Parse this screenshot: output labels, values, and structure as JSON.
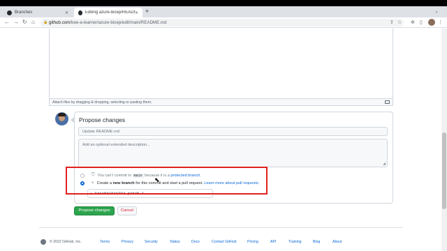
{
  "browser": {
    "tabs": [
      {
        "title": "Branches",
        "active": false
      },
      {
        "title": "Editing azure-bicep/README.m",
        "active": true
      }
    ],
    "new_tab_label": "+",
    "url_host": "github.com",
    "url_path": "/bee-a-learner/azure-bicep/edit/main/README.md"
  },
  "editor": {
    "attach_hint": "Attach files by dragging & dropping, selecting or pasting them."
  },
  "propose": {
    "title": "Propose changes",
    "summary_placeholder": "Update README.md",
    "description_placeholder": "Add an optional extended description...",
    "option_direct": {
      "prefix": "You can't commit to",
      "branch": "main",
      "middle": "because it is a",
      "link": "protected branch",
      "suffix": "."
    },
    "option_new_branch": {
      "prefix": "Create a",
      "bold": "new branch",
      "middle": "for this commit and start a pull request.",
      "link": "Learn more about pull requests."
    },
    "new_branch_name": "krishnakr1994-patch-1",
    "submit_label": "Propose changes",
    "cancel_label": "Cancel"
  },
  "footer": {
    "copyright": "© 2022 GitHub, Inc.",
    "links": [
      "Terms",
      "Privacy",
      "Security",
      "Status",
      "Docs",
      "Contact GitHub",
      "Pricing",
      "API",
      "Training",
      "Blog",
      "About"
    ]
  },
  "colors": {
    "accent": "#0969da",
    "primary_button": "#2da44e",
    "highlight_box": "#e02020",
    "cancel_text": "#cf222e"
  }
}
